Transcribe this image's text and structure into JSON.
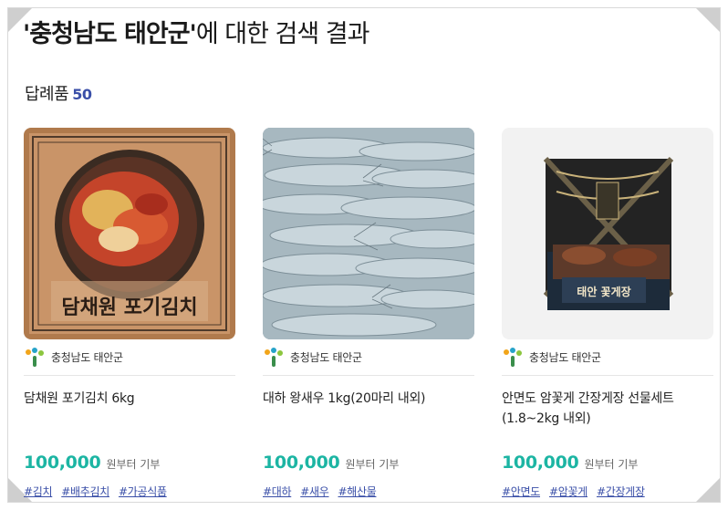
{
  "search": {
    "term_quoted": "'충청남도 태안군'",
    "suffix": "에 대한 검색 결과"
  },
  "section": {
    "label": "답례품",
    "count": "50"
  },
  "colors": {
    "price": "#1cb5a3",
    "accent_blue": "#3a4fa8"
  },
  "products": [
    {
      "region": "충청남도 태안군",
      "image_text": "담채원 포기김치",
      "name": "담채원 포기김치 6kg",
      "price": "100,000",
      "price_suffix": "원부터 기부",
      "tags": [
        "#김치",
        "#배추김치",
        "#가공식품"
      ]
    },
    {
      "region": "충청남도 태안군",
      "name": "대하 왕새우 1kg(20마리 내외)",
      "price": "100,000",
      "price_suffix": "원부터 기부",
      "tags": [
        "#대하",
        "#새우",
        "#해산물"
      ]
    },
    {
      "region": "충청남도 태안군",
      "image_text": "태안 꽃게장",
      "name": "안면도 암꽃게 간장게장 선물세트(1.8~2kg 내외)",
      "price": "100,000",
      "price_suffix": "원부터 기부",
      "tags": [
        "#안면도",
        "#암꽃게",
        "#간장게장"
      ]
    }
  ]
}
